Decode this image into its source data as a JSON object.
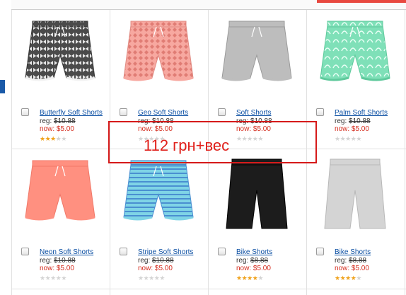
{
  "colors": {
    "link": "#0b4fa3",
    "sale": "#d42c1e",
    "star": "#f0a21c",
    "annotation": "#d61a1a"
  },
  "products": [
    {
      "name": "Butterfly Soft Shorts",
      "reg_label": "reg:",
      "reg_price": "$10.88",
      "now_label": "now:",
      "now_price": "$5.00",
      "rating": 3,
      "art": "butterfly"
    },
    {
      "name": "Geo Soft Shorts",
      "reg_label": "reg:",
      "reg_price": "$10.88",
      "now_label": "now:",
      "now_price": "$5.00",
      "rating": 0,
      "art": "geo"
    },
    {
      "name": "Soft Shorts",
      "reg_label": "reg:",
      "reg_price": "$10.88",
      "now_label": "now:",
      "now_price": "$5.00",
      "rating": 0,
      "art": "grey"
    },
    {
      "name": "Palm Soft Shorts",
      "reg_label": "reg:",
      "reg_price": "$10.88",
      "now_label": "now:",
      "now_price": "$5.00",
      "rating": 0,
      "art": "palm"
    },
    {
      "name": "Neon Soft Shorts",
      "reg_label": "reg:",
      "reg_price": "$10.88",
      "now_label": "now:",
      "now_price": "$5.00",
      "rating": 0,
      "art": "neon"
    },
    {
      "name": "Stripe Soft Shorts",
      "reg_label": "reg:",
      "reg_price": "$10.88",
      "now_label": "now:",
      "now_price": "$5.00",
      "rating": 0,
      "art": "stripe"
    },
    {
      "name": "Bike Shorts",
      "reg_label": "reg:",
      "reg_price": "$8.88",
      "now_label": "now:",
      "now_price": "$5.00",
      "rating": 4,
      "art": "black"
    },
    {
      "name": "Bike Shorts",
      "reg_label": "reg:",
      "reg_price": "$8.88",
      "now_label": "now:",
      "now_price": "$5.00",
      "rating": 4,
      "art": "lightgrey"
    }
  ],
  "annotation": {
    "text": "112 грн+вес"
  }
}
